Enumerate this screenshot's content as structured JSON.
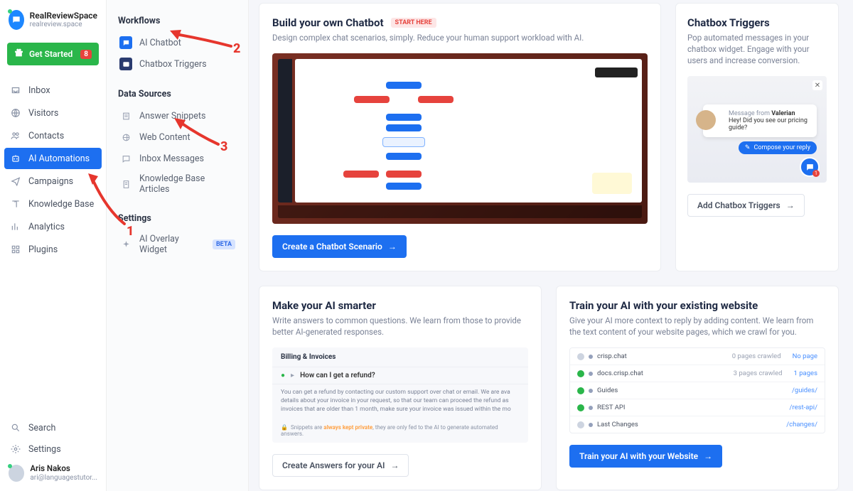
{
  "app": {
    "name": "RealReviewSpace",
    "domain": "realreview.space"
  },
  "get_started": {
    "label": "Get Started",
    "count": "8"
  },
  "nav": {
    "inbox": "Inbox",
    "visitors": "Visitors",
    "contacts": "Contacts",
    "ai_automations": "AI Automations",
    "campaigns": "Campaigns",
    "knowledge_base": "Knowledge Base",
    "analytics": "Analytics",
    "plugins": "Plugins",
    "search": "Search",
    "settings": "Settings"
  },
  "user": {
    "name": "Aris Nakos",
    "email": "ari@languagestutor..."
  },
  "sub": {
    "workflows_title": "Workflows",
    "ai_chatbot": "AI Chatbot",
    "chatbox_triggers": "Chatbox Triggers",
    "data_sources_title": "Data Sources",
    "answer_snippets": "Answer Snippets",
    "web_content": "Web Content",
    "inbox_messages": "Inbox Messages",
    "kb_articles": "Knowledge Base Articles",
    "settings_title": "Settings",
    "ai_overlay": "AI Overlay Widget",
    "beta": "BETA"
  },
  "chatbot": {
    "title": "Build your own Chatbot",
    "pill": "START HERE",
    "desc": "Design complex chat scenarios, simply. Reduce your human support workload with AI.",
    "cta": "Create a Chatbot Scenario"
  },
  "triggers": {
    "title": "Chatbox Triggers",
    "desc": "Pop automated messages in your chatbox widget. Engage with your users and increase conversion.",
    "from": "Message from ",
    "from_name": "Valerian",
    "msg": "Hey! Did you see our pricing guide?",
    "compose": "Compose your reply",
    "alert": "1",
    "cta": "Add Chatbox Triggers"
  },
  "smarter": {
    "title": "Make your AI smarter",
    "desc": "Write answers to common questions. We learn from those to provide better AI-generated responses.",
    "section": "Billing & Invoices",
    "question": "How can I get a refund?",
    "answer": "You can get a refund by contacting our custom support over chat or email. We are ava details about your invoice in your request, so that our team can proceed the refund as invoices that are older than 1 month, make sure your invoice was issued within the mo",
    "privacy_pre": "Snippets are ",
    "privacy_bold": "always kept private",
    "privacy_post": ", they are only fed to the AI to generate automated answers.",
    "cta": "Create Answers for your AI"
  },
  "train": {
    "title": "Train your AI with your existing website",
    "desc": "Give your AI more context to reply by adding content. We learn from the text content of your website pages, which we crawl for you.",
    "rows": [
      {
        "status": "gr",
        "name": "crisp.chat",
        "crawled": "0 pages crawled",
        "link": "No page"
      },
      {
        "status": "g",
        "name": "docs.crisp.chat",
        "crawled": "3 pages crawled",
        "link": "1 pages"
      },
      {
        "status": "g",
        "name": "Guides",
        "crawled": "",
        "link": "/guides/"
      },
      {
        "status": "g",
        "name": "REST API",
        "crawled": "",
        "link": "/rest-api/"
      },
      {
        "status": "gr",
        "name": "Last Changes",
        "crawled": "",
        "link": "/changes/"
      }
    ],
    "cta": "Train your AI with your Website"
  },
  "anno": {
    "one": "1",
    "two": "2",
    "three": "3"
  }
}
